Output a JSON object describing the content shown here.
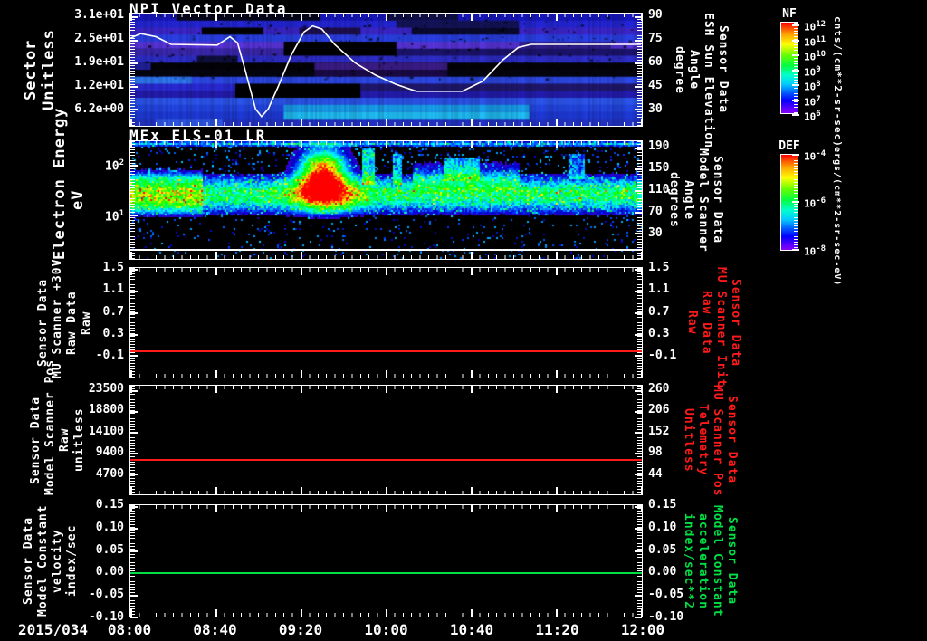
{
  "figure": {
    "date_label": "2015/034",
    "x_ticks": [
      "08:00",
      "08:40",
      "09:20",
      "10:00",
      "10:40",
      "11:20",
      "12:00"
    ],
    "x_range": [
      "08:00",
      "12:00"
    ],
    "background": "#000000",
    "axis_color": "#ffffff"
  },
  "colorbars": [
    {
      "title": "NF",
      "ticks": [
        "10^12",
        "10^11",
        "10^10",
        "10^9",
        "10^8",
        "10^7",
        "10^6"
      ],
      "units": "cnts/(cm**2-sr-sec)"
    },
    {
      "title": "DEF",
      "ticks": [
        "10^-4",
        "10^-6",
        "10^-8"
      ],
      "units": "ergs/(cm**2-sr-sec-eV)"
    }
  ],
  "chart_data": [
    {
      "type": "heatmap",
      "title": "NPI Vector Data",
      "ylabel_left": [
        "Sector",
        "Unitless"
      ],
      "yticks_left": [
        "3.1e+01",
        "2.5e+01",
        "1.9e+01",
        "1.2e+01",
        "6.2e+00"
      ],
      "ylabel_right": [
        "Sensor Data",
        "ESH Sun Elevation",
        "Angle",
        "degree"
      ],
      "yticks_right": [
        "90",
        "75",
        "60",
        "45",
        "30"
      ],
      "colorbar": "NF",
      "overlay_line": {
        "label": "ESH Sun Elevation Angle",
        "color": "#ffffff",
        "range": [
          19,
          92
        ],
        "points": [
          [
            0,
            76
          ],
          [
            0.02,
            79
          ],
          [
            0.05,
            77
          ],
          [
            0.08,
            72
          ],
          [
            0.17,
            71.5
          ],
          [
            0.195,
            77
          ],
          [
            0.21,
            73
          ],
          [
            0.225,
            55
          ],
          [
            0.245,
            30
          ],
          [
            0.257,
            25
          ],
          [
            0.27,
            30
          ],
          [
            0.29,
            45
          ],
          [
            0.315,
            65
          ],
          [
            0.34,
            80
          ],
          [
            0.357,
            84
          ],
          [
            0.375,
            82
          ],
          [
            0.4,
            72
          ],
          [
            0.44,
            60
          ],
          [
            0.48,
            52
          ],
          [
            0.52,
            46
          ],
          [
            0.56,
            41.5
          ],
          [
            0.65,
            41.5
          ],
          [
            0.69,
            48
          ],
          [
            0.73,
            62
          ],
          [
            0.76,
            70
          ],
          [
            0.785,
            72
          ],
          [
            1,
            72
          ]
        ]
      },
      "rows": [
        {
          "c": "#1818c0",
          "s": [
            [
              0.09,
              0.37,
              "#05051a"
            ],
            [
              0.5,
              0.64,
              "#101048"
            ]
          ]
        },
        {
          "c": "#2426d8",
          "s": [
            [
              0.52,
              0.76,
              "#14145a"
            ]
          ]
        },
        {
          "c": "#3c26cc",
          "s": [
            [
              0.14,
              0.26,
              "#000000"
            ],
            [
              0.33,
              0.45,
              "#1e1050"
            ],
            [
              0.55,
              0.76,
              "#0a0a30"
            ]
          ]
        },
        {
          "c": "#2b40e8",
          "s": []
        },
        {
          "c": "#5a35dd",
          "s": [
            [
              0.3,
              0.52,
              "#000000"
            ],
            [
              0.76,
              0.94,
              "#322090"
            ]
          ]
        },
        {
          "c": "#1d1470",
          "s": [
            [
              0.0,
              0.3,
              "#3b28b0"
            ],
            [
              0.3,
              0.52,
              "#000000"
            ]
          ]
        },
        {
          "c": "#2e2ecc",
          "s": [
            [
              0.13,
              0.21,
              "#101040"
            ]
          ]
        },
        {
          "c": "#030308",
          "s": [
            [
              0.0,
              0.04,
              "#2222a0"
            ],
            [
              0.36,
              0.62,
              "#3c1d88"
            ]
          ]
        },
        {
          "c": "#050510",
          "s": [
            [
              0.36,
              0.62,
              "#1c0a48"
            ]
          ]
        },
        {
          "c": "#2d49e8",
          "s": [
            [
              0.0,
              0.12,
              "#2f7af5"
            ]
          ]
        },
        {
          "c": "#2a2ad8",
          "s": [
            [
              0.205,
              0.45,
              "#000000"
            ],
            [
              0.45,
              1.0,
              "#20186e"
            ]
          ]
        },
        {
          "c": "#241cb0",
          "s": [
            [
              0.205,
              0.45,
              "#000000"
            ]
          ]
        },
        {
          "c": "#2c55ee",
          "s": []
        },
        {
          "c": "#2346e4",
          "s": [
            [
              0.3,
              0.78,
              "#18a0ee"
            ]
          ]
        },
        {
          "c": "#1e3ad8",
          "s": [
            [
              0.3,
              0.78,
              "#20c0f8"
            ]
          ]
        },
        {
          "c": "#2334c8",
          "s": [
            [
              0.05,
              0.18,
              "#2f58e8"
            ]
          ]
        }
      ]
    },
    {
      "type": "heatmap",
      "title": "MEx ELS-01 LR",
      "ylabel_left": [
        "Electron Energy",
        "eV"
      ],
      "yticks_left": [
        "10^2",
        "10^1"
      ],
      "ylabel_right": [
        "Sensor Data",
        "Model Scanner",
        "Angle",
        "degrees"
      ],
      "yticks_right": [
        "190",
        "150",
        "110",
        "70",
        "30"
      ],
      "colorbar": "DEF",
      "overlay_line": {
        "label": "Model Scanner Angle",
        "color": "#ffffff",
        "value": 0,
        "range": [
          -18,
          201
        ]
      },
      "features": {
        "noise": [
          {
            "y0": 0.0,
            "y1": 0.27,
            "density": 0.1,
            "vmin": 0.08,
            "vmax": 0.3
          },
          {
            "y0": 0.27,
            "y1": 0.62,
            "density": 0.13,
            "vmin": 0.1,
            "vmax": 0.35
          },
          {
            "y0": 0.62,
            "y1": 1.0,
            "density": 0.06,
            "vmin": 0.08,
            "vmax": 0.28
          }
        ],
        "bands": [
          {
            "x0": 0,
            "x1": 1,
            "y0": 0.33,
            "y1": 0.56,
            "amp": 0.5,
            "soft": 0.08
          },
          {
            "x0": 0,
            "x1": 0.14,
            "y0": 0.26,
            "y1": 0.6,
            "amp": 0.25,
            "soft": 0.05
          },
          {
            "x0": 0.55,
            "x1": 0.76,
            "y0": 0.2,
            "y1": 0.4,
            "amp": 0.2,
            "soft": 0.06
          },
          {
            "x0": 0,
            "x1": 1,
            "y0": 0.0,
            "y1": 0.03,
            "amp": 0.35,
            "soft": 0.02
          }
        ],
        "blobs": [
          {
            "x": 0.375,
            "y": 0.27,
            "rx": 0.033,
            "ry": 0.14,
            "amp": 1.05
          },
          {
            "x": 0.38,
            "y": 0.45,
            "rx": 0.05,
            "ry": 0.1,
            "amp": 0.6
          }
        ],
        "columns": [
          {
            "x": 0.465,
            "w": 0.012,
            "y0": 0.06,
            "y1": 0.36,
            "amp": 0.38
          },
          {
            "x": 0.52,
            "w": 0.01,
            "y0": 0.1,
            "y1": 0.36,
            "amp": 0.33
          },
          {
            "x": 0.645,
            "w": 0.035,
            "y0": 0.13,
            "y1": 0.33,
            "amp": 0.28
          },
          {
            "x": 0.87,
            "w": 0.015,
            "y0": 0.1,
            "y1": 0.32,
            "amp": 0.25
          }
        ]
      }
    },
    {
      "type": "line",
      "ylabel_left": [
        "Sensor Data",
        "MU Scanner +30V",
        "Raw Data",
        "Raw"
      ],
      "yticks_left": [
        "1.5",
        "1.1",
        "0.7",
        "0.3",
        "-0.1"
      ],
      "ylabel_right": [
        "Sensor Data",
        "MU Scanner Init",
        "Raw Data",
        "Raw"
      ],
      "right_label_color": "#ff1a1a",
      "yticks_right": [
        "1.5",
        "1.1",
        "0.7",
        "0.3",
        "-0.1"
      ],
      "series": {
        "name": "MU Scanner +30V Raw",
        "color": "#ff1a1a",
        "value": 0.0,
        "range": [
          -0.5,
          1.5
        ]
      }
    },
    {
      "type": "line",
      "ylabel_left": [
        "Sensor Data",
        "Model Scanner Pos",
        "Raw",
        "unitless"
      ],
      "yticks_left": [
        "23500",
        "18800",
        "14100",
        "9400",
        "4700"
      ],
      "ylabel_right": [
        "Sensor Data",
        "MU Scanner Pos",
        "Telemetry",
        "Unitless"
      ],
      "right_label_color": "#ff1a1a",
      "yticks_right": [
        "260",
        "206",
        "152",
        "98",
        "44"
      ],
      "series": {
        "name": "Model Scanner Pos Raw",
        "color": "#ff1a1a",
        "value": 8000,
        "range": [
          0,
          24500
        ]
      }
    },
    {
      "type": "line",
      "ylabel_left": [
        "Sensor Data",
        "Model Constant",
        "velocity",
        "index/sec"
      ],
      "yticks_left": [
        "0.15",
        "0.10",
        "0.05",
        "0.00",
        "-0.05",
        "-0.10"
      ],
      "ylabel_right": [
        "Sensor Data",
        "Model Constant",
        "acceleration",
        "index/sec**2"
      ],
      "right_label_color": "#00e044",
      "yticks_right": [
        "0.15",
        "0.10",
        "0.05",
        "0.00",
        "-0.05",
        "-0.10"
      ],
      "series": {
        "name": "Model Constant velocity",
        "color": "#00e044",
        "value": 0.0,
        "range": [
          -0.1,
          0.152
        ]
      }
    }
  ]
}
